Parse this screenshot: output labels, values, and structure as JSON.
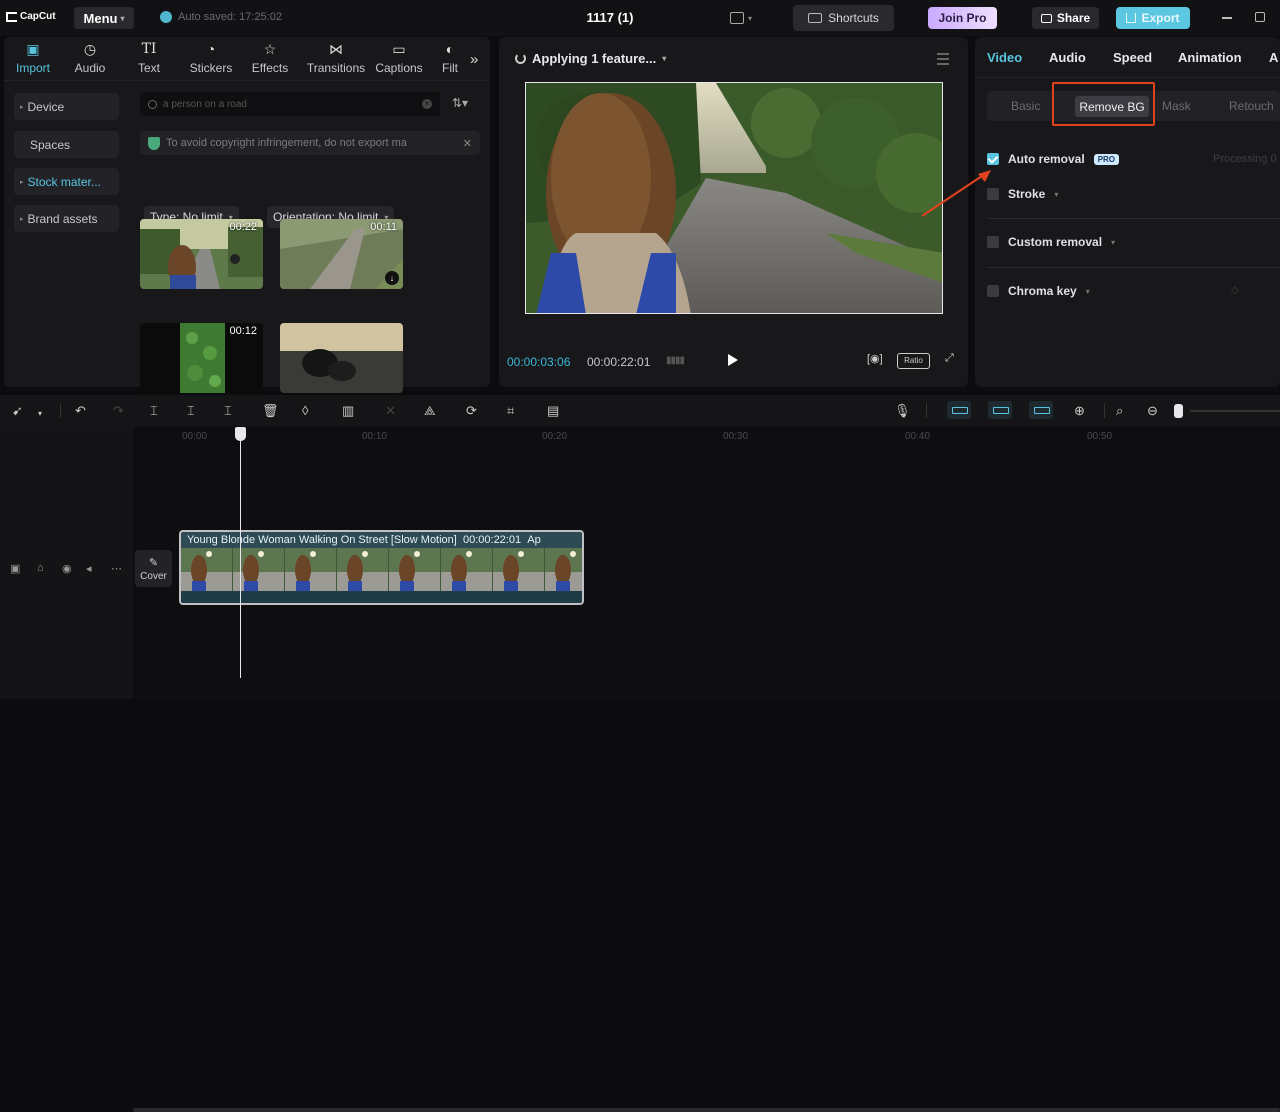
{
  "app": {
    "logo": "CapCut",
    "menu_label": "Menu",
    "autosave": "Auto saved: 17:25:02",
    "project_title": "1117 (1)",
    "shortcuts_label": "Shortcuts",
    "join_pro_label": "Join Pro",
    "share_label": "Share",
    "export_label": "Export"
  },
  "media_tools": [
    {
      "label": "Import",
      "icon": "import-icon",
      "active": true
    },
    {
      "label": "Audio",
      "icon": "audio-icon"
    },
    {
      "label": "Text",
      "icon": "text-icon"
    },
    {
      "label": "Stickers",
      "icon": "stickers-icon"
    },
    {
      "label": "Effects",
      "icon": "effects-icon"
    },
    {
      "label": "Transitions",
      "icon": "transitions-icon"
    },
    {
      "label": "Captions",
      "icon": "captions-icon"
    },
    {
      "label": "Filt",
      "icon": "filters-icon"
    }
  ],
  "side_nav": [
    {
      "label": "Device"
    },
    {
      "label": "Spaces"
    },
    {
      "label": "Stock mater...",
      "selected": true
    },
    {
      "label": "Brand assets"
    }
  ],
  "library": {
    "search_placeholder": "a person on a road",
    "notice": "To avoid copyright infringement, do not export ma",
    "type_filter": "Type: No limit",
    "orientation_filter": "Orientation: No limit",
    "thumbnails": [
      {
        "duration": "00:22"
      },
      {
        "duration": "00:11"
      },
      {
        "duration": "00:12"
      },
      {
        "duration": ""
      }
    ]
  },
  "preview": {
    "status": "Applying 1 feature...",
    "current_time": "00:00:03:06",
    "total_time": "00:00:22:01",
    "ratio_label": "Ratio"
  },
  "properties": {
    "tabs": [
      "Video",
      "Audio",
      "Speed",
      "Animation",
      "A"
    ],
    "subtabs": [
      "Basic",
      "Remove BG",
      "Mask",
      "Retouch"
    ],
    "options": [
      {
        "label": "Auto removal",
        "checked": true,
        "badge": "PRO"
      },
      {
        "label": "Stroke",
        "checked": false
      },
      {
        "label": "Custom removal",
        "checked": false
      },
      {
        "label": "Chroma key",
        "checked": false
      }
    ],
    "processing": "Processing 0"
  },
  "timeline": {
    "ruler": [
      "00:00",
      "00:10",
      "00:20",
      "00:30",
      "00:40",
      "00:50"
    ],
    "cover_label": "Cover",
    "clip": {
      "title": "Young Blonde Woman Walking On Street [Slow Motion]",
      "duration": "00:00:22:01",
      "suffix": "Ap"
    }
  },
  "colors": {
    "accent": "#58c4e0",
    "highlight": "#e0421f",
    "background": "#0c0c0e",
    "panel": "#18181b"
  }
}
